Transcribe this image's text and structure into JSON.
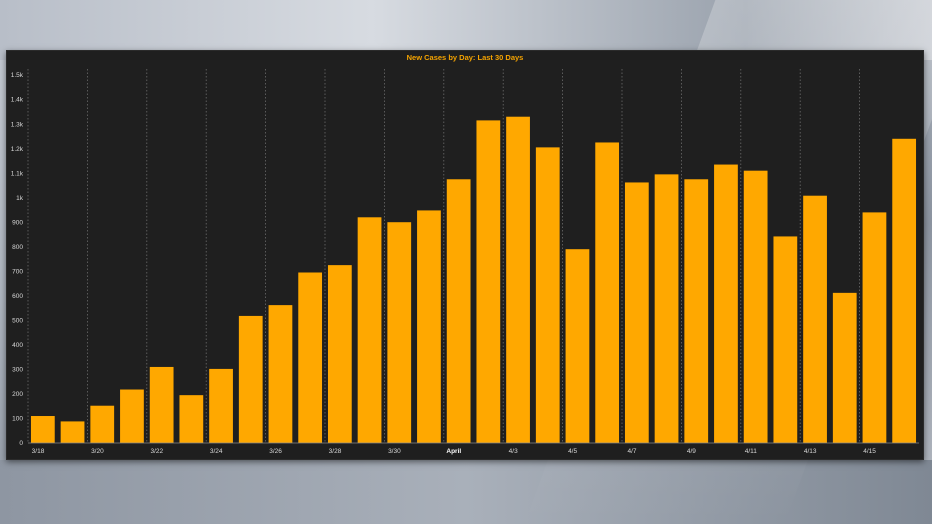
{
  "chart_data": {
    "type": "bar",
    "title": "New Cases by Day: Last 30 Days",
    "xlabel": "",
    "ylabel": "",
    "ylim": [
      0,
      1500
    ],
    "yticks": [
      "0",
      "100",
      "200",
      "300",
      "400",
      "500",
      "600",
      "700",
      "800",
      "900",
      "1k",
      "1.1k",
      "1.2k",
      "1.3k",
      "1.4k",
      "1.5k"
    ],
    "x_tick_labels": [
      {
        "index": 0,
        "label": "3/18"
      },
      {
        "index": 2,
        "label": "3/20"
      },
      {
        "index": 4,
        "label": "3/22"
      },
      {
        "index": 6,
        "label": "3/24"
      },
      {
        "index": 8,
        "label": "3/26"
      },
      {
        "index": 10,
        "label": "3/28"
      },
      {
        "index": 12,
        "label": "3/30"
      },
      {
        "index": 14,
        "label": "April",
        "bold": true
      },
      {
        "index": 16,
        "label": "4/3"
      },
      {
        "index": 18,
        "label": "4/5"
      },
      {
        "index": 20,
        "label": "4/7"
      },
      {
        "index": 22,
        "label": "4/9"
      },
      {
        "index": 24,
        "label": "4/11"
      },
      {
        "index": 26,
        "label": "4/13"
      },
      {
        "index": 28,
        "label": "4/15"
      }
    ],
    "values": [
      110,
      88,
      152,
      218,
      310,
      195,
      302,
      518,
      562,
      695,
      725,
      920,
      900,
      948,
      1075,
      1315,
      1330,
      1205,
      790,
      1225,
      1062,
      1095,
      1075,
      1135,
      1110,
      842,
      1008,
      612,
      940,
      1240
    ],
    "bar_color": "#ffa800",
    "grid": "vertical dotted",
    "legend": "none"
  }
}
